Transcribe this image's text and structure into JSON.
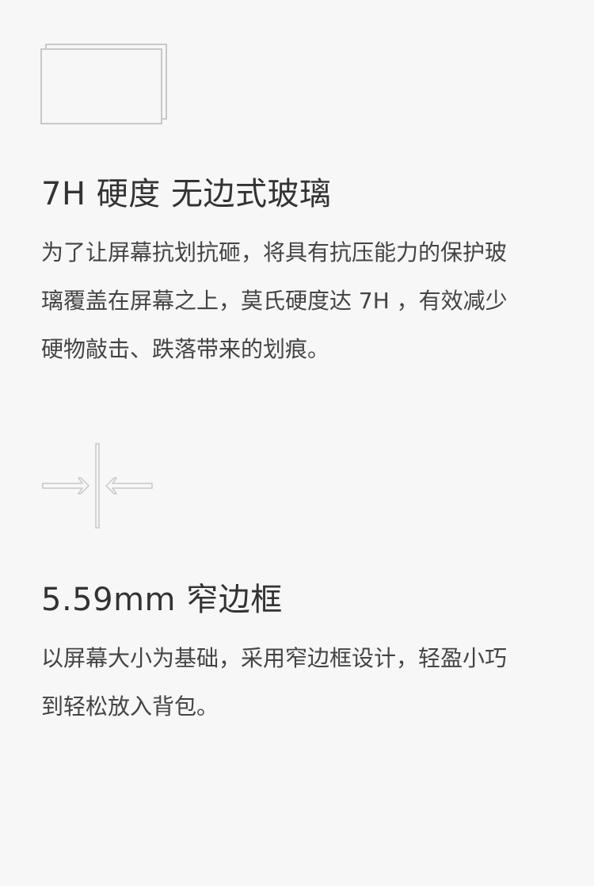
{
  "features": [
    {
      "icon": "glass-sheet-icon",
      "title": "7H 硬度 无边式玻璃",
      "description_lines": [
        "为了让屏幕抗划抗砸，将具有抗压能力的保护玻",
        "璃覆盖在屏幕之上，莫氏硬度达 7H ，有效减少",
        "硬物敲击、跌落带来的划痕。"
      ]
    },
    {
      "icon": "narrow-bezel-arrows-icon",
      "title": "5.59mm 窄边框",
      "description_lines": [
        "以屏幕大小为基础，采用窄边框设计，轻盈小巧",
        "到轻松放入背包。"
      ]
    }
  ],
  "colors": {
    "background": "#f7f7f7",
    "text": "#333333",
    "icon_stroke": "#c8c8c8"
  }
}
